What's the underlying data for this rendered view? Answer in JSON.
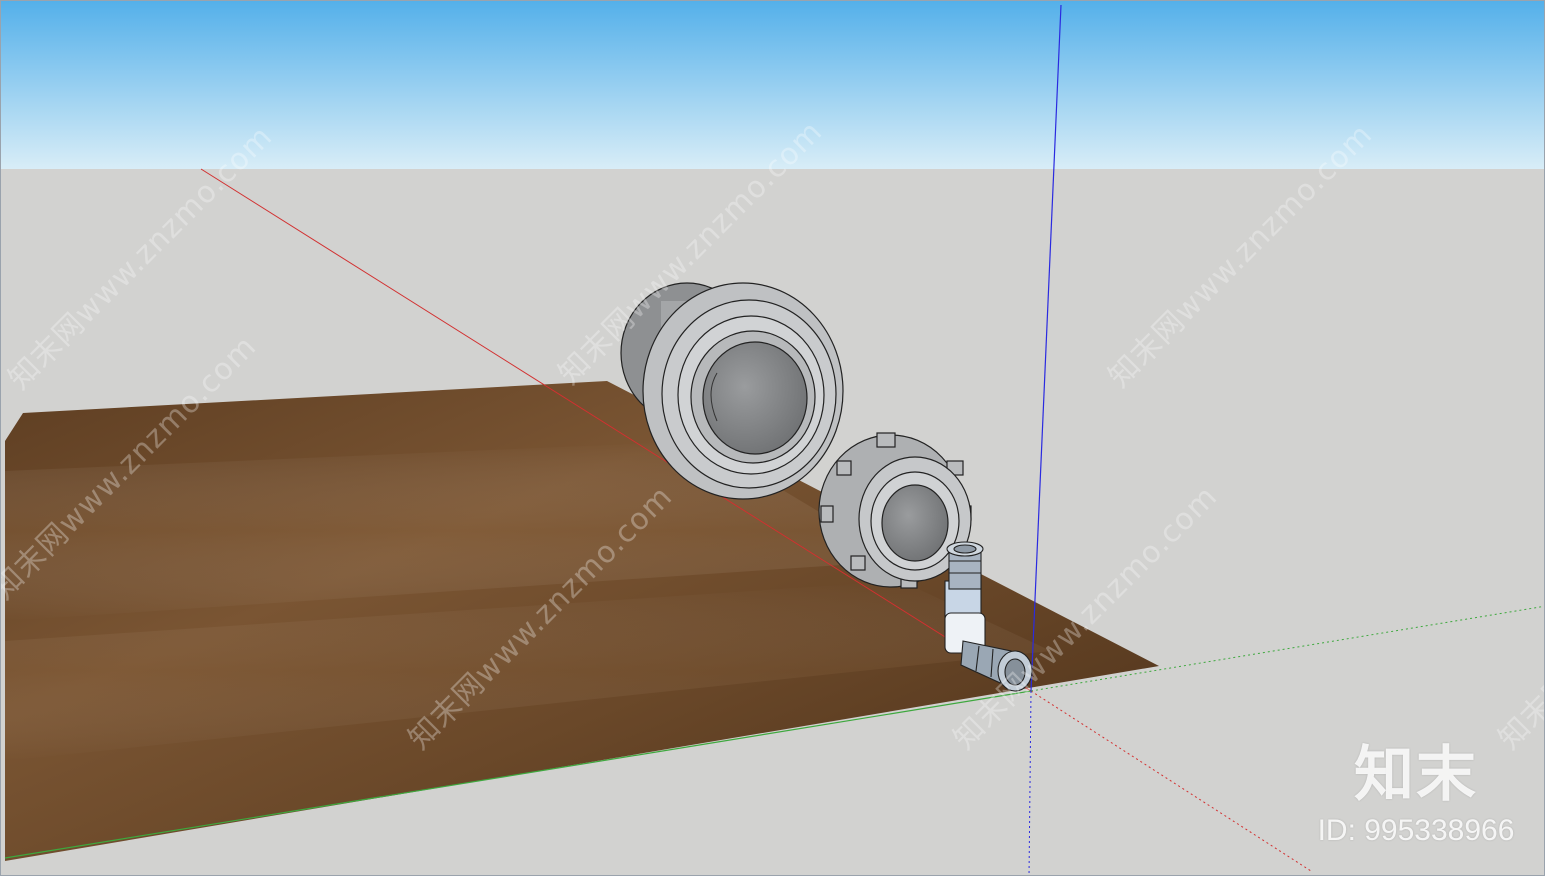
{
  "viewport": {
    "sky_color_top": "#54b0ea",
    "sky_color_bottom": "#d6ecf6",
    "ground_color": "#d2d2d0",
    "floor_color": "#6b4a2c",
    "axis_colors": {
      "x": "#d23030",
      "y": "#3ea83e",
      "z": "#2a2ae0"
    }
  },
  "watermarks": [
    "知末网www.znzmo.com",
    "知末网www.znzmo.com",
    "知末网www.znzmo.com",
    "知末网www.znzmo.com",
    "知末网www.znzmo.com",
    "知末网www.znzmo.com",
    "知末网www.znzmo.com"
  ],
  "brand": {
    "logo": "知末",
    "id_text": "ID: 995338966"
  },
  "model": {
    "parts": [
      "large-pipe-fitting",
      "union-nut",
      "elbow-hose-barb"
    ],
    "part_color": "#b9bbbd"
  }
}
